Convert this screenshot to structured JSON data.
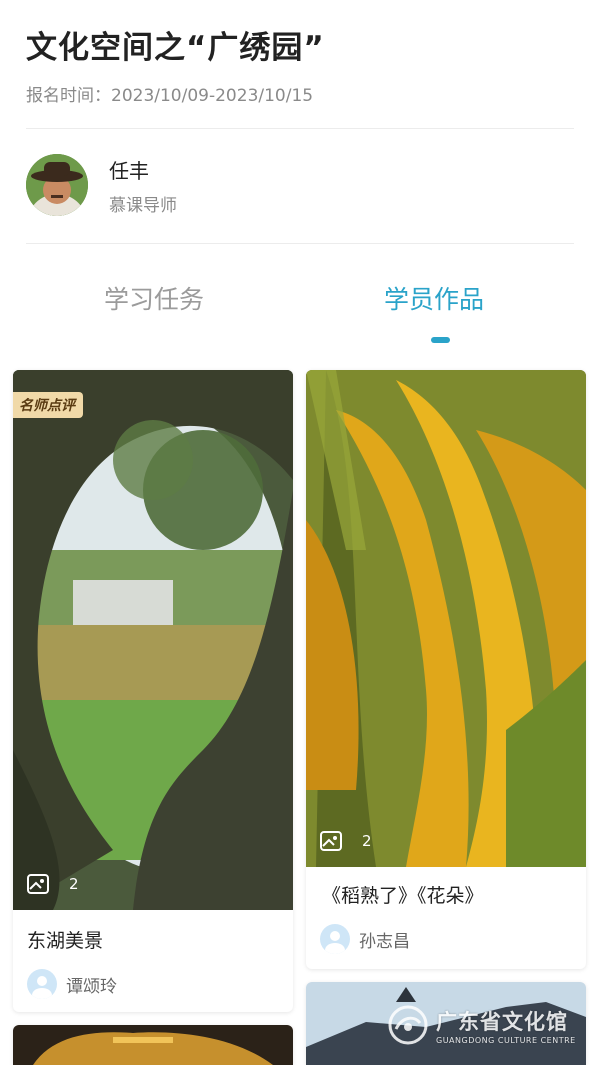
{
  "header": {
    "title": "文化空间之“广绣园”",
    "signup_time": "报名时间：2023/10/09-2023/10/15"
  },
  "teacher": {
    "name": "任丰",
    "role": "慕课导师"
  },
  "tabs": [
    {
      "label": "学习任务",
      "active": false
    },
    {
      "label": "学员作品",
      "active": true
    }
  ],
  "works": [
    {
      "badge": "名师点评",
      "image_count": "2",
      "title": "东湖美景",
      "author": "谭颂玲",
      "image": "garden-lake-photo"
    },
    {
      "image_count": "2",
      "title": "《稻熟了》《花朵》",
      "author": "孙志昌",
      "image": "rice-field-photo"
    }
  ],
  "watermark": {
    "cn": "广东省文化馆",
    "en": "GUANGDONG CULTURE CENTRE"
  },
  "colors": {
    "accent": "#2aa3c9",
    "badge_bg": "#f0d9a8"
  }
}
